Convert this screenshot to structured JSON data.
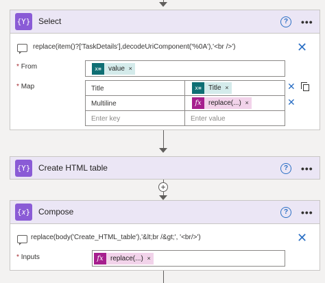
{
  "colors": {
    "header_bg": "#ebe6f5",
    "action_icon": "#8a5bd6",
    "dynamic_token": "#0f6f74",
    "expression_token": "#a61f8e",
    "link_blue": "#2b6fc4"
  },
  "select": {
    "title": "Select",
    "icon": "{Y}",
    "comment": "replace(item()?['TaskDetails'],decodeUriComponent('%0A'),'<br />')",
    "from_label": "From",
    "from_token": "value",
    "map_label": "Map",
    "rows": [
      {
        "key": "Title",
        "value_token": "Title",
        "value_type": "dynamic"
      },
      {
        "key": "Multiline",
        "value_token": "replace(...)",
        "value_type": "expression"
      }
    ],
    "key_placeholder": "Enter key",
    "value_placeholder": "Enter value"
  },
  "create_html": {
    "title": "Create HTML table",
    "icon": "{Y}"
  },
  "compose": {
    "title": "Compose",
    "icon": "{𝑥}",
    "comment": "replace(body('Create_HTML_table'),'&lt;br /&gt;', '<br/>')",
    "inputs_label": "Inputs",
    "inputs_token": "replace(...)"
  },
  "glyphs": {
    "help": "?",
    "more": "•••",
    "close": "✕",
    "remove": "×",
    "add": "+",
    "required": "*",
    "dynamic_icon": "x≡",
    "expression_icon": "fx"
  }
}
